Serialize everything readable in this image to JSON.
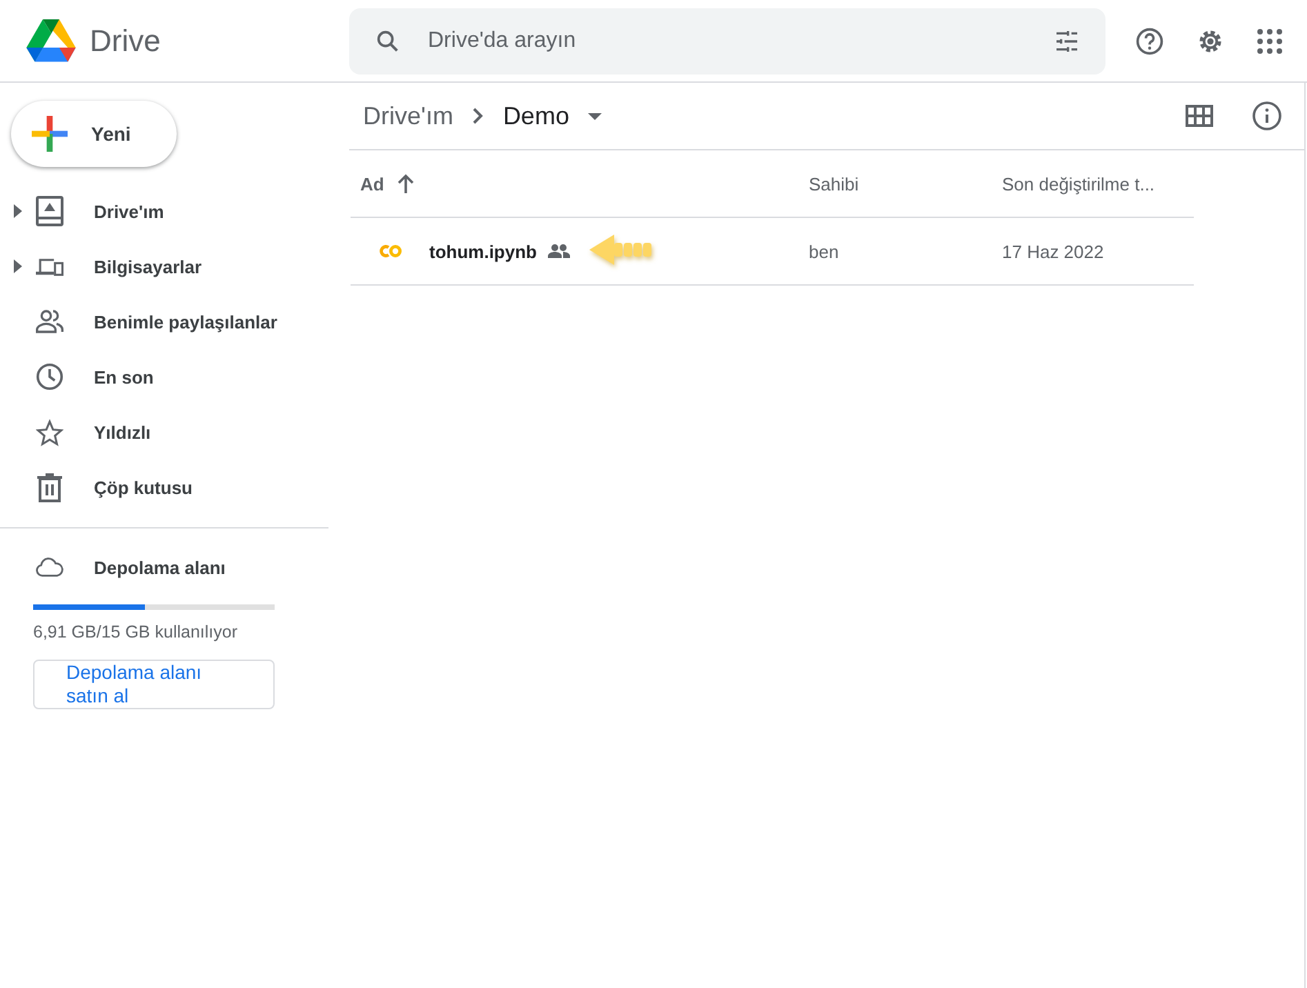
{
  "app": {
    "title": "Drive"
  },
  "search": {
    "placeholder": "Drive'da arayın"
  },
  "new_button": {
    "label": "Yeni"
  },
  "sidebar": {
    "items": [
      {
        "label": "Drive'ım",
        "expandable": true
      },
      {
        "label": "Bilgisayarlar",
        "expandable": true
      },
      {
        "label": "Benimle paylaşılanlar",
        "expandable": false
      },
      {
        "label": "En son",
        "expandable": false
      },
      {
        "label": "Yıldızlı",
        "expandable": false
      },
      {
        "label": "Çöp kutusu",
        "expandable": false
      }
    ]
  },
  "storage": {
    "label": "Depolama alanı",
    "level": 0.46,
    "usage": "6,91 GB/15 GB kullanılıyor",
    "button": "Depolama alanı satın al"
  },
  "breadcrumb": [
    "Drive'ım",
    "Demo"
  ],
  "table": {
    "columns": [
      "Ad",
      "Sahibi",
      "Son değiştirilme t..."
    ],
    "rows": [
      {
        "name": "tohum.ipynb",
        "shared": true,
        "owner": "ben",
        "modified": "17 Haz 2022"
      }
    ]
  }
}
